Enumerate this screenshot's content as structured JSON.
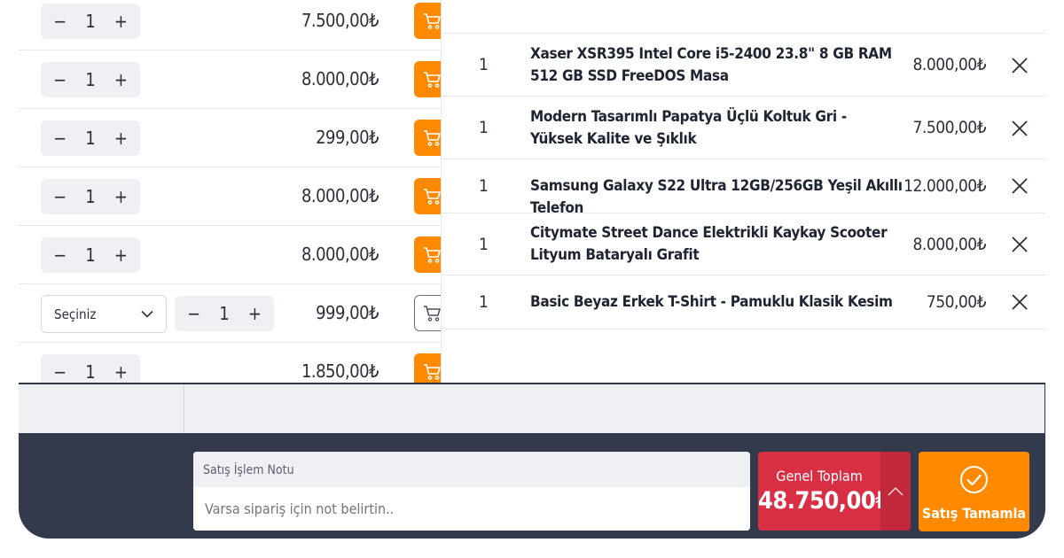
{
  "product_list": [
    {
      "qty": "1",
      "price": "7.500,00₺",
      "cart": "filled"
    },
    {
      "qty": "1",
      "price": "8.000,00₺",
      "cart": "filled"
    },
    {
      "qty": "1",
      "price": "299,00₺",
      "cart": "filled"
    },
    {
      "qty": "1",
      "price": "8.000,00₺",
      "cart": "filled"
    },
    {
      "qty": "1",
      "price": "8.000,00₺",
      "cart": "filled"
    },
    {
      "qty": "1",
      "price": "999,00₺",
      "cart": "outline",
      "variant_select": "Seçiniz"
    },
    {
      "qty": "1",
      "price": "1.850,00₺",
      "cart": "filled"
    }
  ],
  "stepper": {
    "minus": "−",
    "plus": "+"
  },
  "cart_items": [
    {
      "qty": "1",
      "name": "Xaser XSR395 Intel Core i5-2400 23.8\" 8 GB RAM 512 GB SSD FreeDOS Masa",
      "price": "8.000,00₺"
    },
    {
      "qty": "1",
      "name": "Modern Tasarımlı Papatya Üçlü Koltuk Gri - Yüksek Kalite ve Şıklık",
      "price": "7.500,00₺"
    },
    {
      "qty": "1",
      "name": "Samsung Galaxy S22 Ultra 12GB/256GB Yeşil Akıllı Telefon",
      "price": "12.000,00₺"
    },
    {
      "qty": "1",
      "name": "Citymate Street Dance Elektrikli Kaykay Scooter Lityum Bataryalı Grafit",
      "price": "8.000,00₺"
    },
    {
      "qty": "1",
      "name": "Basic Beyaz Erkek T-Shirt - Pamuklu Klasik Kesim",
      "price": "750,00₺"
    }
  ],
  "footer": {
    "note_label": "Satış İşlem Notu",
    "note_placeholder": "Varsa sipariş için not belirtin..",
    "total_label": "Genel Toplam",
    "total_value": "48.750,00₺",
    "complete_label": "Satış Tamamla"
  },
  "colors": {
    "accent_orange": "#ff8a00",
    "total_red": "#d92f44",
    "footer_dark": "#333a4b"
  },
  "icons": {
    "cart": "cart-icon",
    "remove": "close-icon",
    "expand": "chevron-up-icon",
    "complete": "check-circle-icon",
    "select": "chevron-down-icon"
  }
}
